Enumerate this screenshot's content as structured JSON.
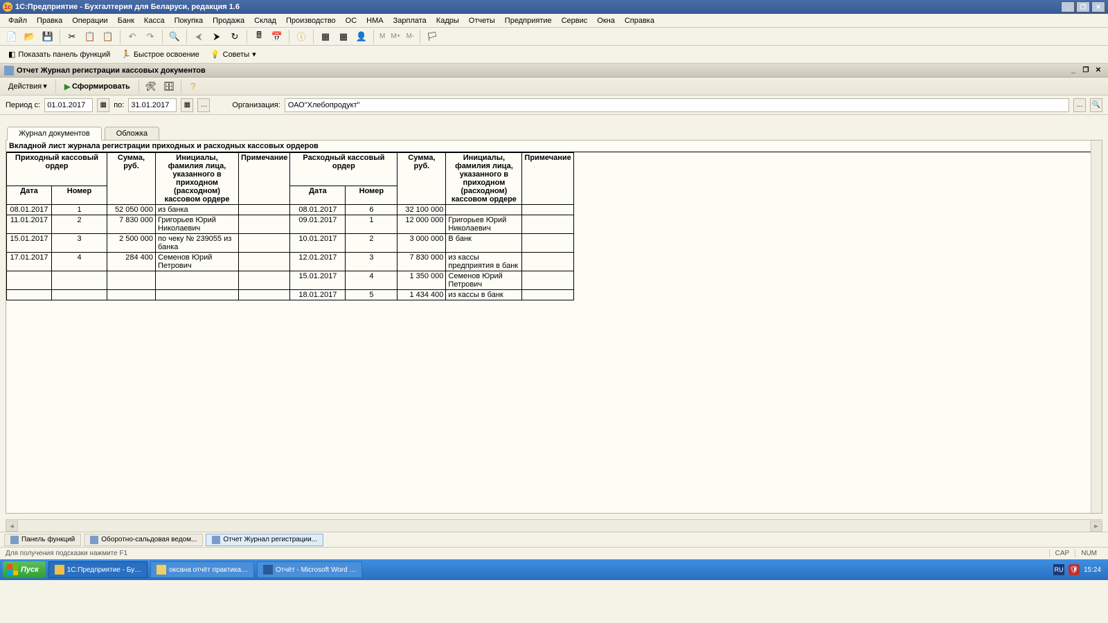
{
  "titlebar": {
    "text": "1С:Предприятие - Бухгалтерия для Беларуси, редакция 1.6"
  },
  "menu": [
    "Файл",
    "Правка",
    "Операции",
    "Банк",
    "Касса",
    "Покупка",
    "Продажа",
    "Склад",
    "Производство",
    "ОС",
    "НМА",
    "Зарплата",
    "Кадры",
    "Отчеты",
    "Предприятие",
    "Сервис",
    "Окна",
    "Справка"
  ],
  "toolbar2": {
    "panel_functions": "Показать панель функций",
    "quick_start": "Быстрое освоение",
    "tips": "Советы"
  },
  "sub": {
    "title": "Отчет Журнал регистрации кассовых документов",
    "actions": "Действия",
    "form": "Сформировать"
  },
  "filter": {
    "period_from_label": "Период с:",
    "from": "01.01.2017",
    "to_label": "по:",
    "to": "31.01.2017",
    "org_label": "Организация:",
    "org": "ОАО\"Хлебопродукт\""
  },
  "tabs": {
    "tab1": "Журнал документов",
    "tab2": "Обложка"
  },
  "report": {
    "title": "Вкладной лист журнала регистрации приходных и расходных кассовых ордеров",
    "h_in_group": "Приходный кассовый ордер",
    "h_sum": "Сумма, руб.",
    "h_person": "Инициалы, фамилия лица, указанного в приходном (расходном) кассовом ордере",
    "h_note": "Примечание",
    "h_out_group": "Расходный кассовый ордер",
    "h_date": "Дата",
    "h_num": "Номер",
    "rows": [
      {
        "d1": "08.01.2017",
        "n1": "1",
        "s1": "52 050 000",
        "p1": "из банка",
        "note1": "",
        "d2": "08.01.2017",
        "n2": "6",
        "s2": "32 100 000",
        "p2": "",
        "note2": ""
      },
      {
        "d1": "11.01.2017",
        "n1": "2",
        "s1": "7 830 000",
        "p1": "Григорьев Юрий Николаевич",
        "note1": "",
        "d2": "09.01.2017",
        "n2": "1",
        "s2": "12 000 000",
        "p2": "Григорьев Юрий Николаевич",
        "note2": ""
      },
      {
        "d1": "15.01.2017",
        "n1": "3",
        "s1": "2 500 000",
        "p1": "по чеку № 239055 из банка",
        "note1": "",
        "d2": "10.01.2017",
        "n2": "2",
        "s2": "3 000 000",
        "p2": "В банк",
        "note2": ""
      },
      {
        "d1": "17.01.2017",
        "n1": "4",
        "s1": "284 400",
        "p1": "Семенов Юрий Петрович",
        "note1": "",
        "d2": "12.01.2017",
        "n2": "3",
        "s2": "7 830 000",
        "p2": "из кассы предприятия в банк",
        "note2": ""
      },
      {
        "d1": "",
        "n1": "",
        "s1": "",
        "p1": "",
        "note1": "",
        "d2": "15.01.2017",
        "n2": "4",
        "s2": "1 350 000",
        "p2": "Семенов Юрий Петрович",
        "note2": ""
      },
      {
        "d1": "",
        "n1": "",
        "s1": "",
        "p1": "",
        "note1": "",
        "d2": "18.01.2017",
        "n2": "5",
        "s2": "1 434 400",
        "p2": "из кассы в банк",
        "note2": ""
      }
    ]
  },
  "doc_tabs": {
    "t1": "Панель функций",
    "t2": "Оборотно-сальдовая ведом...",
    "t3": "Отчет Журнал регистрации..."
  },
  "status": {
    "hint": "Для получения подсказки нажмите F1",
    "cap": "CAP",
    "num": "NUM"
  },
  "taskbar": {
    "start": "Пуск",
    "b1": "1С:Предприятие - Бу…",
    "b2": "оксана отчёт практика…",
    "b3": "Отчёт - Microsoft Word …",
    "lang": "RU",
    "time": "15:24"
  }
}
